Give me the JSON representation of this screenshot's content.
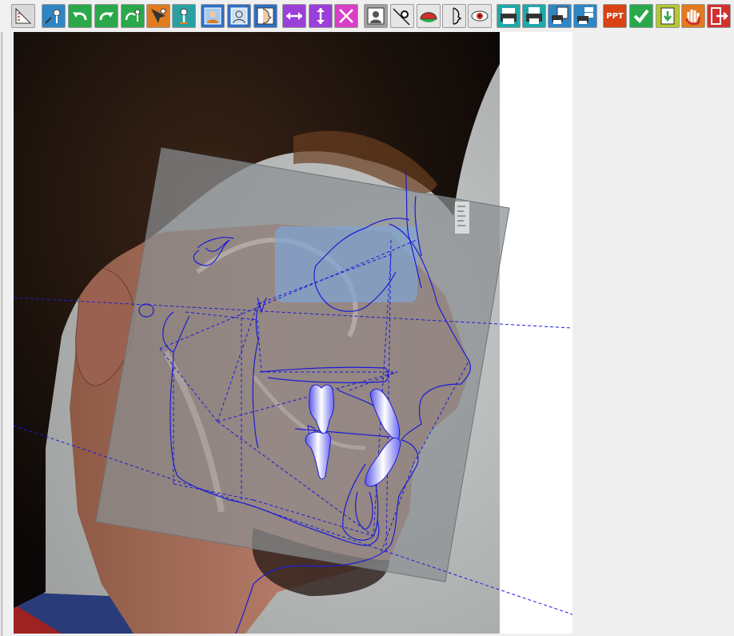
{
  "toolbar": {
    "buttons": [
      {
        "name": "ruler-calibrate-button",
        "icon": "ruler-corner-icon",
        "color": "#d9d9d9",
        "fg": "#c0392b"
      },
      {
        "name": "digitize-point-button",
        "icon": "pin-point-icon",
        "color": "#2f86c5"
      },
      {
        "name": "undo-button",
        "icon": "undo-arrow-icon",
        "color": "#2aa84a"
      },
      {
        "name": "redo-button",
        "icon": "redo-arrow-icon",
        "color": "#2aa84a"
      },
      {
        "name": "redigitize-button",
        "icon": "refresh-point-icon",
        "color": "#2aa84a"
      },
      {
        "name": "move-point-button",
        "icon": "cursor-point-icon",
        "color": "#e07b1f"
      },
      {
        "name": "point-info-button",
        "icon": "pin-info-icon",
        "color": "#2aa0a0"
      },
      {
        "name": "photo-profile-button",
        "icon": "portrait-photo-icon",
        "color": "#2f6fc5"
      },
      {
        "name": "xray-overlay-button",
        "icon": "portrait-xray-icon",
        "color": "#2f6fc5"
      },
      {
        "name": "profile-trace-button",
        "icon": "face-profile-icon",
        "color": "#2f6fc5"
      },
      {
        "name": "stretch-horizontal-button",
        "icon": "arrows-horizontal-icon",
        "color": "#9b3fd9"
      },
      {
        "name": "stretch-vertical-button",
        "icon": "arrows-vertical-icon",
        "color": "#9b3fd9"
      },
      {
        "name": "resize-diagonal-button",
        "icon": "arrows-diagonal-icon",
        "color": "#d93fc5"
      },
      {
        "name": "grey-portrait-button",
        "icon": "grey-portrait-icon",
        "color": "#a0a0a0"
      },
      {
        "name": "trace-point-button",
        "icon": "pin-line-icon",
        "color": "#e6e6e6"
      },
      {
        "name": "soft-tissue-button",
        "icon": "red-dome-icon",
        "color": "#e6e6e6"
      },
      {
        "name": "face-outline-button",
        "icon": "face-outline-icon",
        "color": "#e6e6e6"
      },
      {
        "name": "view-button",
        "icon": "eye-icon",
        "color": "#e6e6e6"
      },
      {
        "name": "print-button",
        "icon": "printer-icon",
        "color": "#1fa8a8"
      },
      {
        "name": "print-preview-button",
        "icon": "printer-page-icon",
        "color": "#1fa8a8"
      },
      {
        "name": "print-report-button",
        "icon": "printer-report-icon",
        "color": "#2f86c5"
      },
      {
        "name": "print-batch-button",
        "icon": "printer-stack-icon",
        "color": "#2f86c5"
      },
      {
        "name": "export-ppt-button",
        "icon": "ppt-icon",
        "color": "#d84315",
        "label": "PPT"
      },
      {
        "name": "confirm-button",
        "icon": "checkmark-icon",
        "color": "#2aa84a"
      },
      {
        "name": "save-download-button",
        "icon": "download-doc-icon",
        "color": "#b5c832"
      },
      {
        "name": "hand-tool-button",
        "icon": "hand-icon",
        "color": "#e07b1f"
      },
      {
        "name": "exit-button",
        "icon": "exit-door-icon",
        "color": "#d0312d"
      }
    ]
  },
  "workspace": {
    "trace_color": "#1c1cd6",
    "tooth_fill": "#7b7bf0"
  }
}
